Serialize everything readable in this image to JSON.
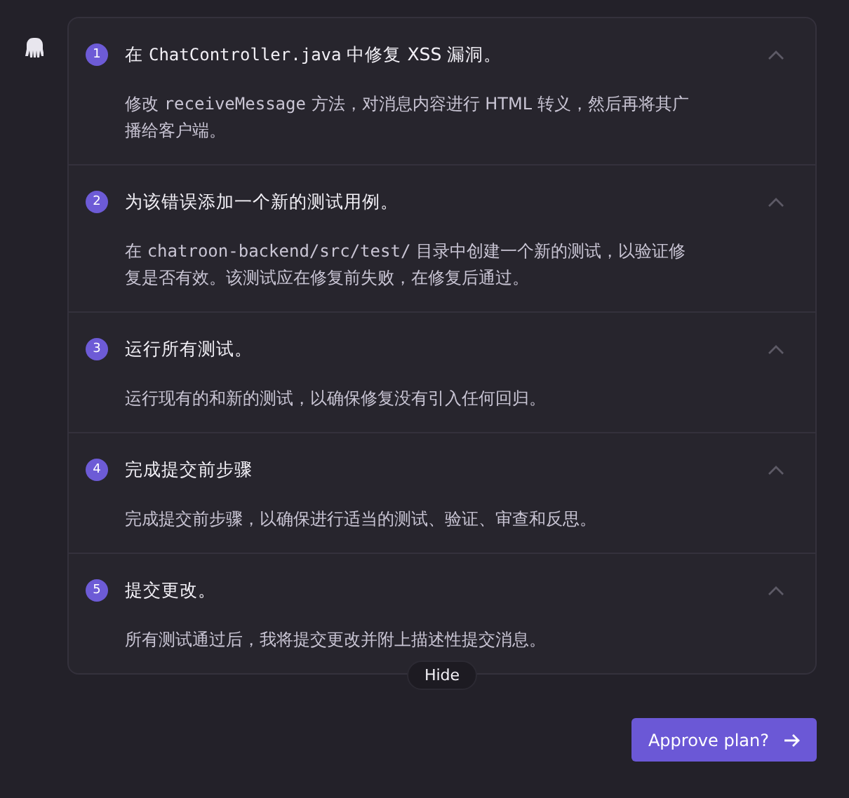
{
  "steps": [
    {
      "number": "1",
      "expanded": true,
      "title": [
        {
          "kind": "text",
          "text": "在 "
        },
        {
          "kind": "code",
          "text": "ChatController.java"
        },
        {
          "kind": "text",
          "text": " 中修复 XSS 漏洞。"
        }
      ],
      "description": [
        {
          "kind": "text",
          "text": "修改 "
        },
        {
          "kind": "code",
          "text": "receiveMessage"
        },
        {
          "kind": "text",
          "text": " 方法，对消息内容进行 HTML 转义，然后再将其广播给客户端。"
        }
      ]
    },
    {
      "number": "2",
      "expanded": true,
      "title": [
        {
          "kind": "text",
          "text": "为该错误添加一个新的测试用例。"
        }
      ],
      "description": [
        {
          "kind": "text",
          "text": "在 "
        },
        {
          "kind": "code",
          "text": "chatroon-backend/src/test/"
        },
        {
          "kind": "text",
          "text": " 目录中创建一个新的测试，以验证修复是否有效。该测试应在修复前失败，在修复后通过。"
        }
      ]
    },
    {
      "number": "3",
      "expanded": true,
      "title": [
        {
          "kind": "text",
          "text": "运行所有测试。"
        }
      ],
      "description": [
        {
          "kind": "text",
          "text": "运行现有的和新的测试，以确保修复没有引入任何回归。"
        }
      ]
    },
    {
      "number": "4",
      "expanded": true,
      "title": [
        {
          "kind": "text",
          "text": "完成提交前步骤"
        }
      ],
      "description": [
        {
          "kind": "text",
          "text": "完成提交前步骤，以确保进行适当的测试、验证、审查和反思。"
        }
      ]
    },
    {
      "number": "5",
      "expanded": true,
      "title": [
        {
          "kind": "text",
          "text": "提交更改。"
        }
      ],
      "description": [
        {
          "kind": "text",
          "text": "所有测试通过后，我将提交更改并附上描述性提交消息。"
        }
      ]
    }
  ],
  "hide_button": "Hide",
  "approve_button": "Approve plan?"
}
